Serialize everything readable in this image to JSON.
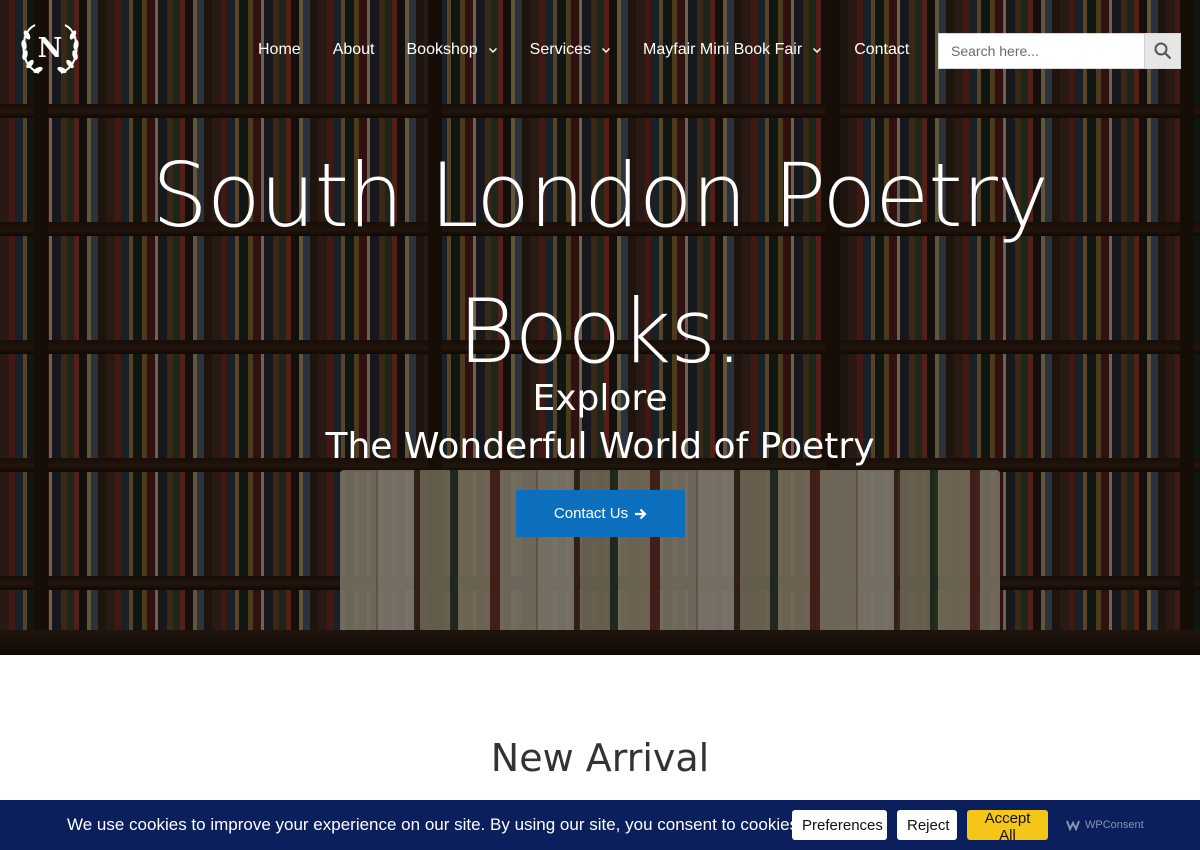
{
  "header": {
    "logo_letter": "N",
    "nav": [
      {
        "label": "Home",
        "has_dropdown": false
      },
      {
        "label": "About",
        "has_dropdown": false
      },
      {
        "label": "Bookshop",
        "has_dropdown": true
      },
      {
        "label": "Services",
        "has_dropdown": true
      },
      {
        "label": "Mayfair Mini Book Fair",
        "has_dropdown": true
      },
      {
        "label": "Contact",
        "has_dropdown": false
      }
    ],
    "search": {
      "placeholder": "Search here...",
      "value": ""
    }
  },
  "hero": {
    "title_line1": "South London Poetry",
    "title_line2": "Books.",
    "subtitle_line1": "Explore",
    "subtitle_line2": "The Wonderful World of Poetry",
    "cta_label": "Contact Us",
    "cta_icon": "arrow-right-icon"
  },
  "main": {
    "section_title": "New Arrival"
  },
  "cookie_bar": {
    "message": "We use cookies to improve your experience on our site. By using our site, you consent to cookies.",
    "preferences_label": "Preferences",
    "reject_label": "Reject",
    "accept_label": "Accept All",
    "brand_label": "WPConsent"
  },
  "colors": {
    "accent_blue": "#0c6fbe",
    "cookie_bar_bg": "#0a1f5c",
    "accept_yellow": "#f5c518"
  }
}
